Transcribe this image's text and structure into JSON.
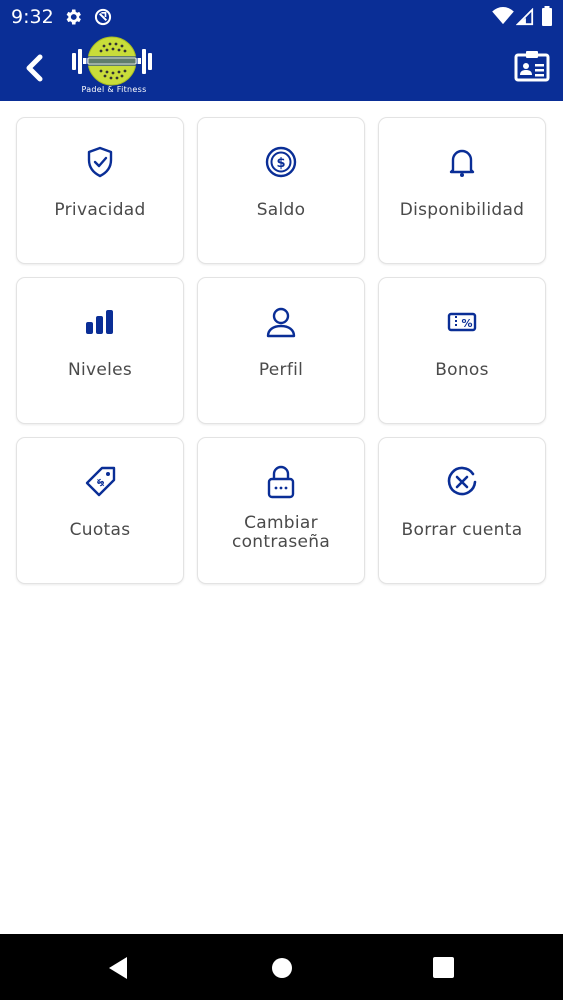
{
  "status_bar": {
    "time": "9:32",
    "icons": [
      "gear-icon",
      "sync-off-icon",
      "wifi-icon",
      "signal-icon",
      "battery-icon"
    ]
  },
  "app_bar": {
    "background_color": "#0a2e96",
    "back_icon": "chevron-left-icon",
    "logo_text": "Padel & Fitness",
    "action_icon": "id-card-icon"
  },
  "menu": {
    "accent_color": "#0a2e96",
    "tiles": [
      {
        "label": "Privacidad",
        "icon": "shield-check-icon"
      },
      {
        "label": "Saldo",
        "icon": "dollar-coin-icon"
      },
      {
        "label": "Disponibilidad",
        "icon": "bell-icon"
      },
      {
        "label": "Niveles",
        "icon": "bar-chart-icon"
      },
      {
        "label": "Perfil",
        "icon": "user-icon"
      },
      {
        "label": "Bonos",
        "icon": "discount-ticket-icon"
      },
      {
        "label": "Cuotas",
        "icon": "price-tag-icon"
      },
      {
        "label": "Cambiar contraseña",
        "icon": "lock-icon"
      },
      {
        "label": "Borrar cuenta",
        "icon": "close-circle-icon"
      }
    ]
  },
  "nav_bar": {
    "icons": [
      "nav-back-icon",
      "nav-home-icon",
      "nav-recents-icon"
    ]
  }
}
